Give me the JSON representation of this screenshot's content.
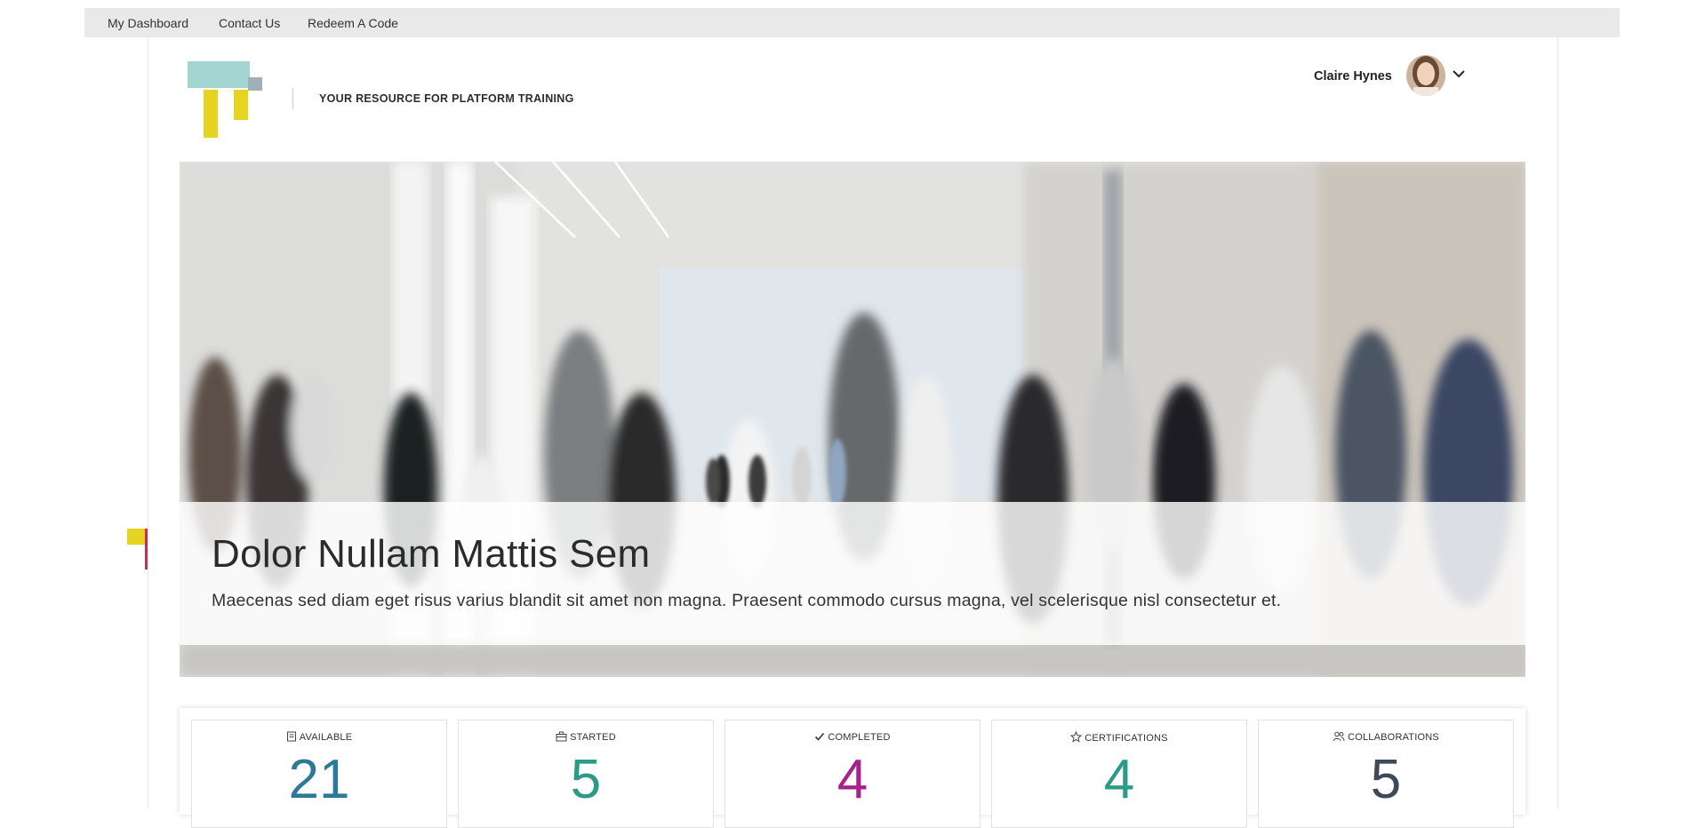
{
  "topnav": {
    "items": [
      {
        "label": "My Dashboard"
      },
      {
        "label": "Contact Us"
      },
      {
        "label": "Redeem A Code"
      }
    ]
  },
  "header": {
    "tagline": "YOUR RESOURCE FOR PLATFORM TRAINING",
    "user_name": "Claire Hynes",
    "logo_colors": {
      "teal": "#a3d6d2",
      "yellow": "#e6d420",
      "gray": "#9fb0b8"
    }
  },
  "hero": {
    "title": "Dolor Nullam Mattis Sem",
    "subtitle": "Maecenas sed diam eget risus varius blandit sit amet non magna. Praesent commodo cursus magna, vel scelerisque nisl consectetur et."
  },
  "stats": [
    {
      "label": "AVAILABLE",
      "value": "21",
      "icon": "book-icon",
      "color": "#2b7a9a"
    },
    {
      "label": "STARTED",
      "value": "5",
      "icon": "briefcase-icon",
      "color": "#2b9a86"
    },
    {
      "label": "COMPLETED",
      "value": "4",
      "icon": "check-icon",
      "color": "#a8208c"
    },
    {
      "label": "CERTIFICATIONS",
      "value": "4",
      "icon": "star-icon",
      "color": "#2b9a86"
    },
    {
      "label": "COLLABORATIONS",
      "value": "5",
      "icon": "people-icon",
      "color": "#3e4a5a"
    }
  ]
}
